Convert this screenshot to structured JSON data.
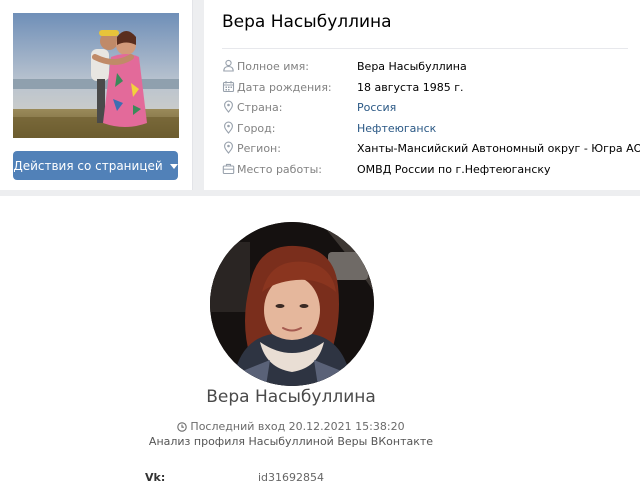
{
  "profile": {
    "name": "Вера Насыбуллина",
    "actions_button": "Действия со страницей",
    "info": [
      {
        "icon": "person-icon",
        "label": "Полное имя:",
        "value": "Вера Насыбуллина",
        "link": false
      },
      {
        "icon": "calendar-icon",
        "label": "Дата рождения:",
        "value": "18 августа 1985 г.",
        "link": false
      },
      {
        "icon": "location-icon",
        "label": "Страна:",
        "value": "Россия",
        "link": true
      },
      {
        "icon": "location-icon",
        "label": "Город:",
        "value": "Нефтеюганск",
        "link": true
      },
      {
        "icon": "location-icon",
        "label": "Регион:",
        "value": "Ханты-Мансийский Автономный округ - Югра АО",
        "link": false
      },
      {
        "icon": "briefcase-icon",
        "label": "Место работы:",
        "value": "ОМВД России по г.Нефтеюганску",
        "link": false
      }
    ]
  },
  "analysis": {
    "name": "Вера Насыбуллина",
    "last_login": "Последний вход 20.12.2021 15:38:20",
    "caption": "Анализ профиля Насыбуллиной Веры ВКонтакте",
    "vk_label": "Vk:",
    "vk_id": "id31692854"
  },
  "colors": {
    "accent": "#5181b8",
    "link": "#2a5885",
    "label": "#828282",
    "background": "#edeef0"
  }
}
